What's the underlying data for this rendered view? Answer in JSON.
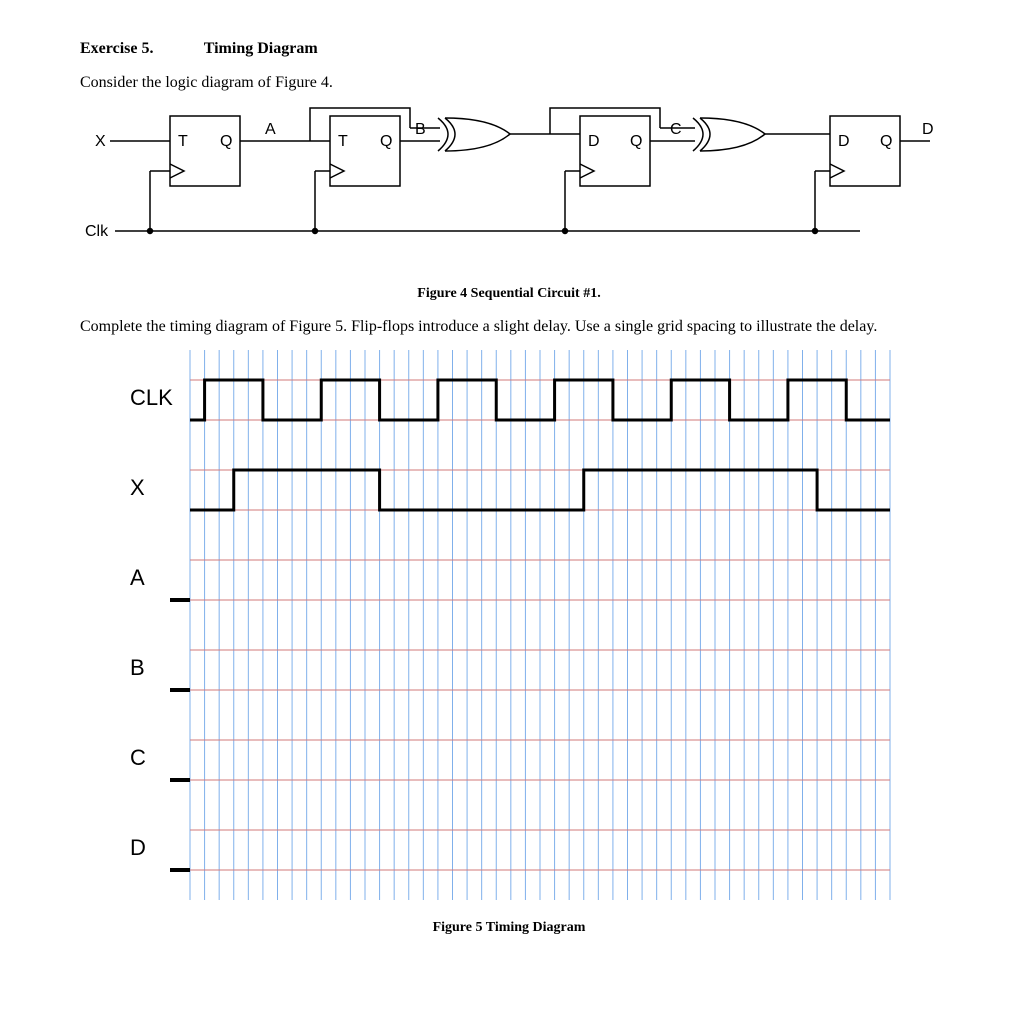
{
  "heading": {
    "exercise": "Exercise 5.",
    "title": "Timing Diagram"
  },
  "intro": "Consider the logic diagram of Figure 4.",
  "circuit": {
    "input_signal": "X",
    "clock_signal": "Clk",
    "ff1": {
      "type": "T",
      "out_label": "Q",
      "wire_label": "A"
    },
    "ff2": {
      "type": "T",
      "out_label": "Q",
      "wire_label": "B"
    },
    "gate1": "XOR",
    "ff3": {
      "type": "D",
      "out_label": "Q",
      "wire_label": "C"
    },
    "gate2": "XOR",
    "ff4": {
      "type": "D",
      "out_label": "Q",
      "wire_label": "D"
    },
    "caption": "Figure 4 Sequential Circuit #1."
  },
  "instruction": "Complete the timing diagram of Figure 5. Flip-flops introduce a slight delay. Use a single grid spacing to illustrate the delay.",
  "timing": {
    "caption": "Figure 5 Timing Diagram",
    "grid_divisions": 48,
    "signals": [
      "CLK",
      "X",
      "A",
      "B",
      "C",
      "D"
    ],
    "CLK": {
      "period_divisions": 8,
      "high_divisions": 4,
      "start_offset": 1,
      "cycles_shown": 6
    },
    "X": {
      "transitions_div": [
        {
          "at": 3,
          "to": 1
        },
        {
          "at": 13,
          "to": 0
        },
        {
          "at": 27,
          "to": 1
        },
        {
          "at": 43,
          "to": 0
        }
      ],
      "initial": 0
    },
    "A": "blank",
    "B": "blank",
    "C": "blank",
    "D": "blank"
  }
}
